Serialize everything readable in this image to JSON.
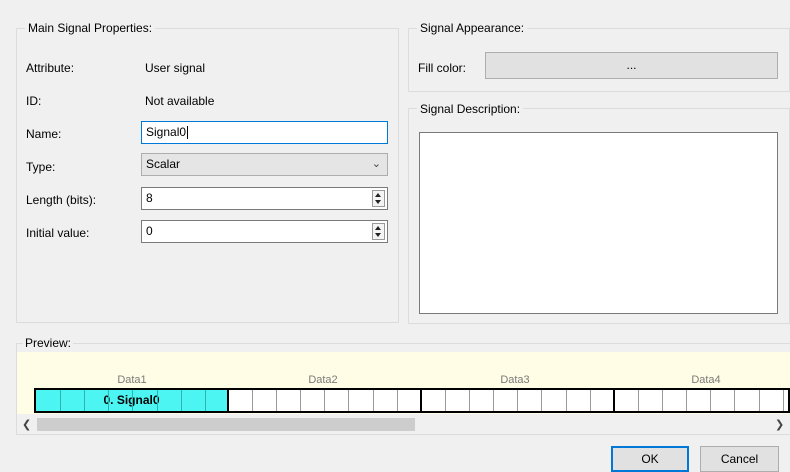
{
  "main": {
    "title": "Main Signal Properties:",
    "attribute_label": "Attribute:",
    "attribute_value": "User signal",
    "id_label": "ID:",
    "id_value": "Not available",
    "name_label": "Name:",
    "name_value": "Signal0",
    "type_label": "Type:",
    "type_value": "Scalar",
    "length_label": "Length (bits):",
    "length_value": "8",
    "initial_label": "Initial value:",
    "initial_value": "0"
  },
  "appearance": {
    "title": "Signal Appearance:",
    "fill_label": "Fill color:",
    "fill_button": "...",
    "fill_color": "#e1e1e1"
  },
  "description": {
    "title": "Signal Description:",
    "value": ""
  },
  "preview": {
    "title": "Preview:",
    "data_labels": [
      "Data1",
      "Data2",
      "Data3",
      "Data4"
    ],
    "signal_label": "0. Signal0",
    "signal_color": "#4cf5f2",
    "background_color": "#fffde6"
  },
  "buttons": {
    "ok": "OK",
    "cancel": "Cancel"
  }
}
